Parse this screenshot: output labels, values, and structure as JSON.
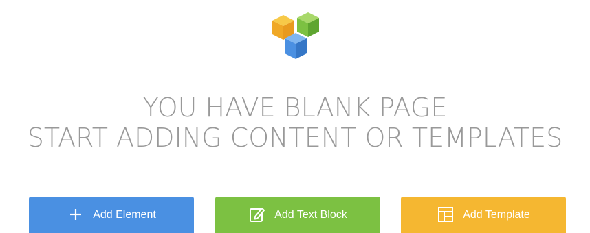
{
  "brand": {
    "logo_icon": "visual-composer-logo-icon",
    "colors": {
      "yellow": "#f5b731",
      "green": "#7cc142",
      "blue": "#4a90e2"
    }
  },
  "headline": {
    "line1": "YOU HAVE BLANK PAGE",
    "line2": "START ADDING CONTENT OR TEMPLATES"
  },
  "actions": [
    {
      "label": "Add Element",
      "icon": "plus-icon",
      "color": "#4a90e2"
    },
    {
      "label": "Add Text Block",
      "icon": "edit-icon",
      "color": "#7cc142"
    },
    {
      "label": "Add Template",
      "icon": "template-icon",
      "color": "#f5b731"
    }
  ]
}
